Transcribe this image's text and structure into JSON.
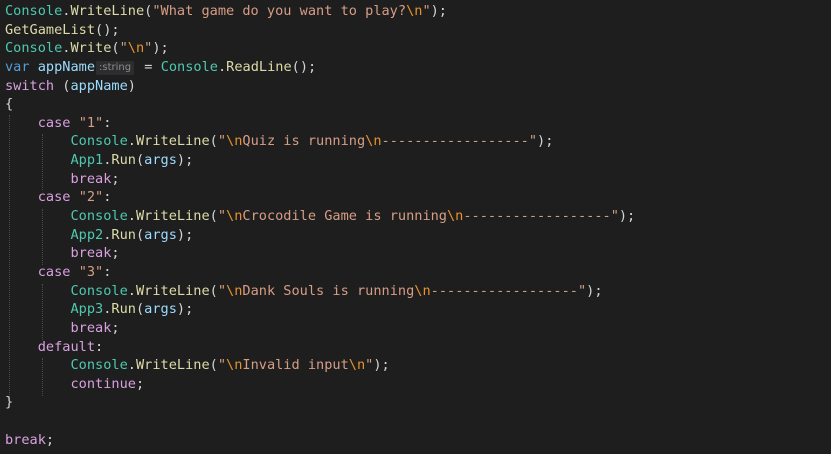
{
  "editor": {
    "hint_type": ":string",
    "lines": [
      [
        "Console",
        ".",
        "WriteLine",
        "(",
        "\"What game do you want to play?",
        "\\n",
        "\"",
        ");"
      ],
      [
        "GetGameList",
        "();"
      ],
      [
        "Console",
        ".",
        "Write",
        "(",
        "\"",
        "\\n",
        "\"",
        ");"
      ],
      [
        "var",
        " ",
        "appName",
        "",
        " = ",
        "Console",
        ".",
        "ReadLine",
        "();"
      ],
      [
        "switch",
        " (",
        "appName",
        ")"
      ],
      [
        "{"
      ],
      [
        "    ",
        "case",
        " ",
        "\"1\"",
        ":"
      ],
      [
        "        ",
        "Console",
        ".",
        "WriteLine",
        "(",
        "\"",
        "\\n",
        "Quiz is running",
        "\\n",
        "------------------\"",
        ");"
      ],
      [
        "        ",
        "App1",
        ".",
        "Run",
        "(",
        "args",
        ");"
      ],
      [
        "        ",
        "break",
        ";"
      ],
      [
        "    ",
        "case",
        " ",
        "\"2\"",
        ":"
      ],
      [
        "        ",
        "Console",
        ".",
        "WriteLine",
        "(",
        "\"",
        "\\n",
        "Crocodile Game is running",
        "\\n",
        "------------------\"",
        ");"
      ],
      [
        "        ",
        "App2",
        ".",
        "Run",
        "(",
        "args",
        ");"
      ],
      [
        "        ",
        "break",
        ";"
      ],
      [
        "    ",
        "case",
        " ",
        "\"3\"",
        ":"
      ],
      [
        "        ",
        "Console",
        ".",
        "WriteLine",
        "(",
        "\"",
        "\\n",
        "Dank Souls is running",
        "\\n",
        "------------------\"",
        ");"
      ],
      [
        "        ",
        "App3",
        ".",
        "Run",
        "(",
        "args",
        ");"
      ],
      [
        "        ",
        "break",
        ";"
      ],
      [
        "    ",
        "default",
        ":"
      ],
      [
        "        ",
        "Console",
        ".",
        "WriteLine",
        "(",
        "\"",
        "\\n",
        "Invalid input",
        "\\n",
        "\"",
        ");"
      ],
      [
        "        ",
        "continue",
        ";"
      ],
      [
        "}"
      ],
      [
        ""
      ],
      [
        "break",
        ";"
      ]
    ]
  }
}
